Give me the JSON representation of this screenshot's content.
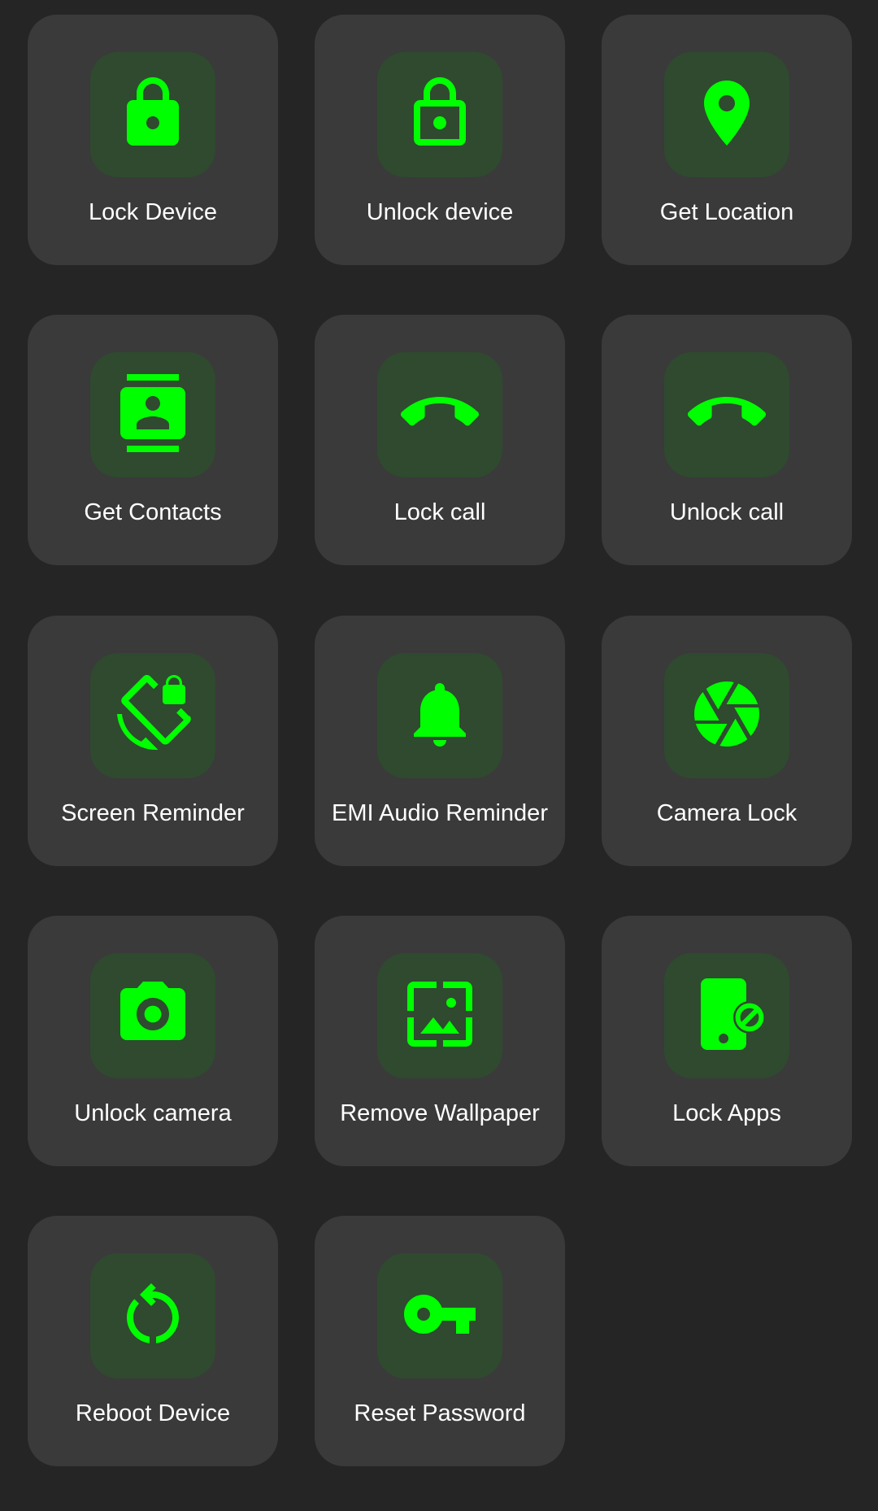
{
  "colors": {
    "background": "#252525",
    "tile": "#3a3a3a",
    "icon_box": "#2f4a2f",
    "accent": "#00ff00",
    "label": "#ffffff"
  },
  "actions": [
    {
      "label": "Lock Device",
      "icon": "lock-icon"
    },
    {
      "label": "Unlock device",
      "icon": "unlock-icon"
    },
    {
      "label": "Get Location",
      "icon": "location-pin-icon"
    },
    {
      "label": "Get Contacts",
      "icon": "contacts-icon"
    },
    {
      "label": "Lock call",
      "icon": "call-end-icon"
    },
    {
      "label": "Unlock call",
      "icon": "call-end-icon"
    },
    {
      "label": "Screen Reminder",
      "icon": "screen-rotation-lock-icon"
    },
    {
      "label": "EMI Audio Reminder",
      "icon": "bell-icon"
    },
    {
      "label": "Camera Lock",
      "icon": "camera-shutter-icon"
    },
    {
      "label": "Unlock camera",
      "icon": "camera-icon"
    },
    {
      "label": "Remove Wallpaper",
      "icon": "wallpaper-icon"
    },
    {
      "label": "Lock Apps",
      "icon": "phone-blocked-icon"
    },
    {
      "label": "Reboot Device",
      "icon": "restart-icon"
    },
    {
      "label": "Reset Password",
      "icon": "key-icon"
    }
  ]
}
